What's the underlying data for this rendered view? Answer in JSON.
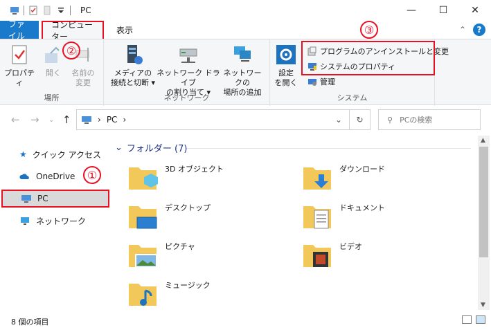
{
  "window": {
    "title": "PC"
  },
  "tabs": {
    "file": "ファイル",
    "computer": "コンピューター",
    "view": "表示"
  },
  "ribbon": {
    "groups": {
      "location": "場所",
      "network": "ネットワーク",
      "system": "システム"
    },
    "location": {
      "properties": "プロパティ",
      "open": "開く",
      "rename_1": "名前の",
      "rename_2": "変更"
    },
    "network": {
      "media_1": "メディアの",
      "media_2": "接続と切断",
      "map_1": "ネットワーク ドライブ",
      "map_2": "の割り当て",
      "add_1": "ネットワークの",
      "add_2": "場所の追加"
    },
    "system": {
      "settings_1": "設定",
      "settings_2": "を開く",
      "uninstall": "プログラムのアンインストールと変更",
      "sysprops": "システムのプロパティ",
      "manage": "管理"
    }
  },
  "address": {
    "crumb": "PC",
    "search_placeholder": "PCの検索"
  },
  "nav": {
    "quick": "クイック アクセス",
    "onedrive": "OneDrive",
    "pc": "PC",
    "network": "ネットワーク"
  },
  "content": {
    "section_title": "フォルダー (7)",
    "folders": [
      "3D オブジェクト",
      "ダウンロード",
      "デスクトップ",
      "ドキュメント",
      "ピクチャ",
      "ビデオ",
      "ミュージック"
    ]
  },
  "status": {
    "count": "8 個の項目"
  },
  "annotations": {
    "a1": "①",
    "a2": "②",
    "a3": "③"
  },
  "colors": {
    "accent": "#1979ca",
    "highlight": "#e81123",
    "ribbon_bg": "#f5f6f7"
  }
}
